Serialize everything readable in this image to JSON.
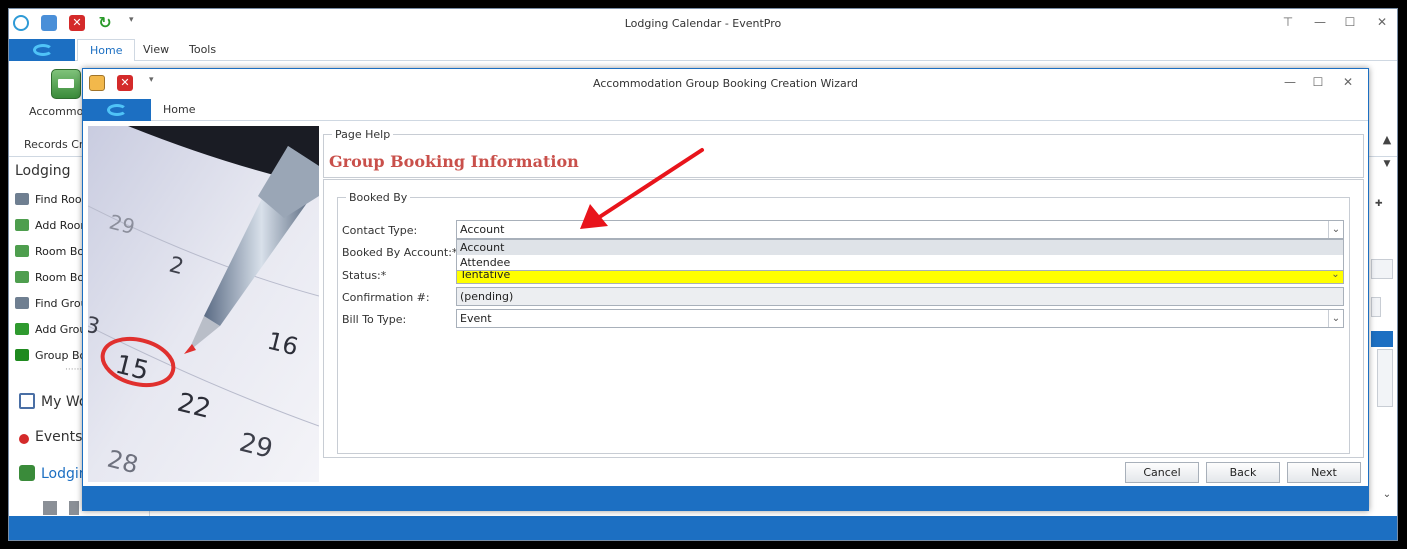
{
  "main_window": {
    "title": "Lodging Calendar - EventPro",
    "tabs": [
      "Home",
      "View",
      "Tools"
    ],
    "ribbon": {
      "big_button_label": "Accommoda",
      "group_label": "Records Cre"
    },
    "nav": {
      "header": "Lodging",
      "items": [
        "Find Room",
        "Add Room",
        "Room Boo",
        "Room Boo",
        "Find Grou",
        "Add Grou",
        "Group Boo"
      ],
      "sections": [
        "My Wo",
        "Events",
        "Lodgin"
      ]
    }
  },
  "wizard": {
    "title": "Accommodation Group Booking Creation Wizard",
    "tab": "Home",
    "page_help_caption": "Page Help",
    "page_title": "Group Booking Information",
    "booked_by_caption": "Booked By",
    "fields": {
      "contact_type": {
        "label": "Contact Type:",
        "value": "Account"
      },
      "booked_by_account": {
        "label": "Booked By Account:*"
      },
      "status": {
        "label": "Status:*",
        "value": "Tentative"
      },
      "confirmation": {
        "label": "Confirmation #:",
        "value": "(pending)"
      },
      "bill_to_type": {
        "label": "Bill To Type:",
        "value": "Event"
      }
    },
    "dropdown_options": [
      "Account",
      "Attendee"
    ],
    "buttons": {
      "cancel": "Cancel",
      "back": "Back",
      "next": "Next"
    },
    "calendar_numbers": [
      "2",
      "3",
      "15",
      "16",
      "22",
      "29",
      "28"
    ]
  },
  "colors": {
    "accent": "#1c6fc2",
    "title_red": "#c9504b",
    "required_yellow": "#ffff00",
    "arrow_red": "#e8141b"
  }
}
